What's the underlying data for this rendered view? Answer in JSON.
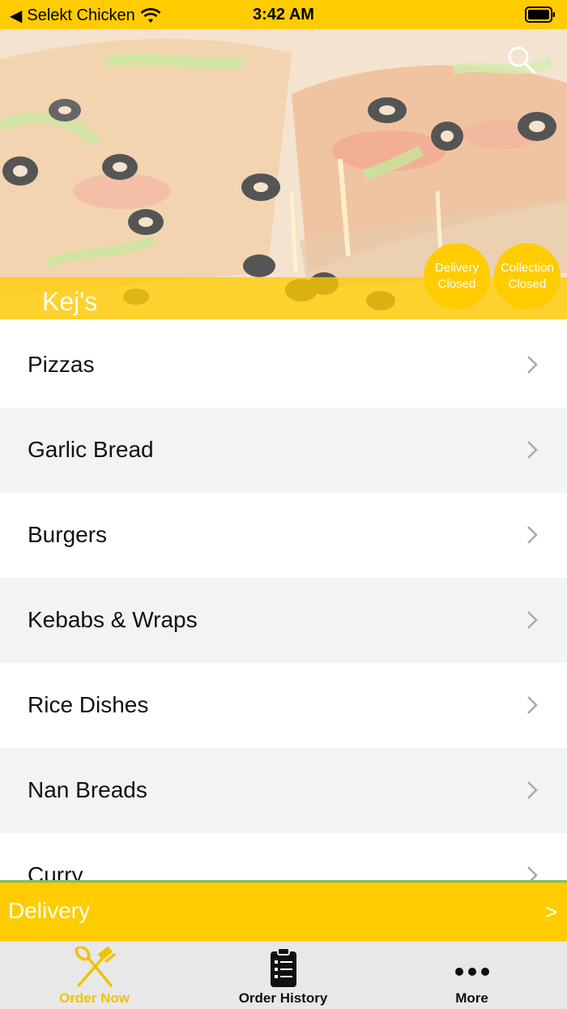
{
  "status_bar": {
    "back_app": "Selekt Chicken",
    "time": "3:42 AM"
  },
  "hero": {
    "restaurant_name": "Kej's",
    "delivery_status": [
      "Delivery",
      "Closed"
    ],
    "collection_status": [
      "Collection",
      "Closed"
    ]
  },
  "menu": {
    "items": [
      {
        "label": "Pizzas"
      },
      {
        "label": "Garlic Bread"
      },
      {
        "label": "Burgers"
      },
      {
        "label": "Kebabs & Wraps"
      },
      {
        "label": "Rice Dishes"
      },
      {
        "label": "Nan Breads"
      },
      {
        "label": "Curry"
      }
    ]
  },
  "delivery_bar": {
    "label": "Delivery",
    "arrow": ">"
  },
  "tabs": [
    {
      "label": "Order Now",
      "icon": "fork-knife-icon",
      "active": true
    },
    {
      "label": "Order History",
      "icon": "clipboard-list-icon",
      "active": false
    },
    {
      "label": "More",
      "icon": "more-dots-icon",
      "active": false
    }
  ],
  "colors": {
    "accent": "#FFCC00",
    "alt_row": "#F2F3F5",
    "tab_bar": "#E8E8E8",
    "active_tab": "#F2C200"
  }
}
